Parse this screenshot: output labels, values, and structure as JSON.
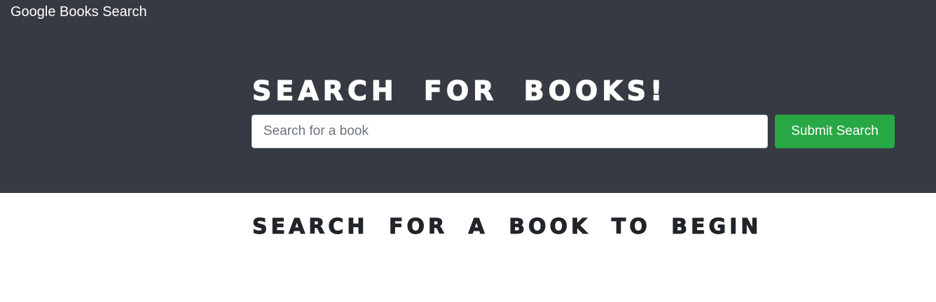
{
  "navbar": {
    "brand": "Google Books Search"
  },
  "hero": {
    "title": "SEARCH FOR BOOKS!"
  },
  "search": {
    "placeholder": "Search for a book",
    "value": "",
    "submit_label": "Submit Search"
  },
  "results": {
    "heading": "SEARCH FOR A BOOK TO BEGIN"
  },
  "colors": {
    "hero_background": "#363a43",
    "submit_button": "#28a745",
    "page_background": "#ffffff"
  }
}
